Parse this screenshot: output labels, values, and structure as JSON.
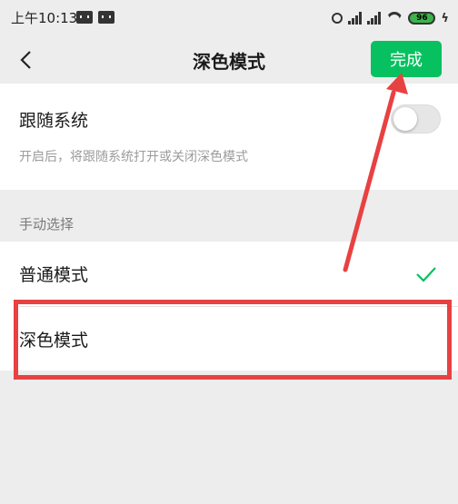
{
  "status_bar": {
    "time": "上午10:13",
    "battery": "96"
  },
  "nav": {
    "title": "深色模式",
    "done_label": "完成"
  },
  "follow_system": {
    "title": "跟随系统",
    "description": "开启后，将跟随系统打开或关闭深色模式",
    "enabled": false
  },
  "manual_section": {
    "label": "手动选择",
    "options": [
      {
        "label": "普通模式",
        "selected": true
      },
      {
        "label": "深色模式",
        "selected": false
      }
    ]
  },
  "colors": {
    "accent": "#07c160",
    "annotation": "#e84142",
    "background": "#ededed",
    "card": "#ffffff"
  },
  "icons": [
    "message-icon",
    "alarm-icon",
    "signal-icon",
    "wifi-icon",
    "battery-icon",
    "charge-icon",
    "back-icon",
    "check-icon"
  ]
}
